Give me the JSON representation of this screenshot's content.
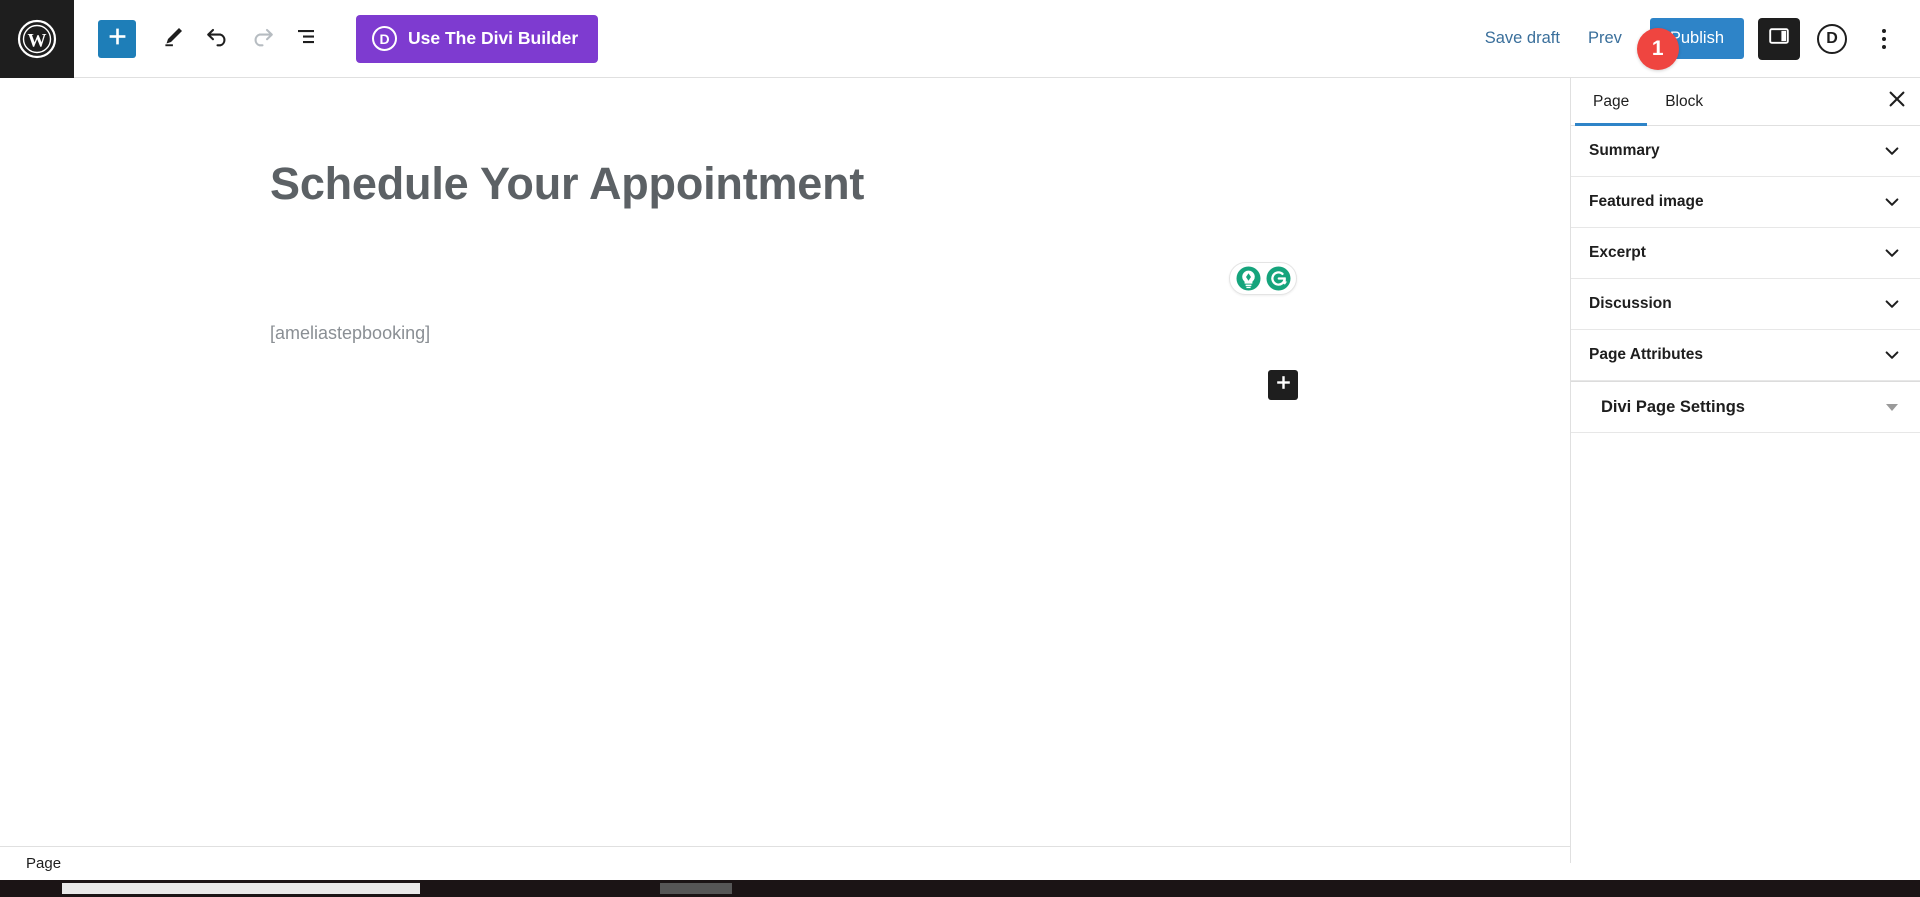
{
  "colors": {
    "accent_blue": "#2e84c8",
    "inserter_blue": "#1e7eb8",
    "divi_purple": "#7e3bd0",
    "badge_red": "#ef4540",
    "grammarly_green": "#15a47c",
    "dark": "#1e1e1e",
    "title_grey": "#5c6165",
    "muted_grey": "#8a8f94"
  },
  "topbar": {
    "wp_logo_icon": "wordpress-logo-icon",
    "left_tools": [
      {
        "icon": "plus-icon",
        "name": "block-inserter-button",
        "label": "Toggle block inserter"
      },
      {
        "icon": "pencil-icon",
        "name": "tools-edit-button",
        "label": "Tools"
      },
      {
        "icon": "undo-arrow-icon",
        "name": "undo-button",
        "label": "Undo"
      },
      {
        "icon": "redo-arrow-icon",
        "name": "redo-button",
        "label": "Redo"
      },
      {
        "icon": "list-view-icon",
        "name": "document-overview-button",
        "label": "Document overview"
      }
    ],
    "divi_builder": {
      "icon": "divi-d-circle-icon",
      "icon_letter": "D",
      "label": "Use The Divi Builder"
    },
    "save_draft_label": "Save draft",
    "preview_label": "Prev",
    "notification_badge": "1",
    "publish_label": "Publish",
    "settings_toggle_icon": "sidebar-panel-icon",
    "divi_icon_letter": "D",
    "options_icon": "kebab-menu-icon"
  },
  "canvas": {
    "post_title": "Schedule Your Appointment",
    "paragraph": "[ameliastepbooking]",
    "grammarly": {
      "bulb_icon": "grammarly-lightbulb-icon",
      "rewrite_icon": "grammarly-rewrite-icon"
    },
    "block_appender_icon": "plus-icon"
  },
  "sidebar": {
    "tabs": [
      {
        "label": "Page",
        "active": true
      },
      {
        "label": "Block",
        "active": false
      }
    ],
    "close_icon": "close-icon",
    "panels": [
      {
        "label": "Summary",
        "icon": "chevron-down-icon"
      },
      {
        "label": "Featured image",
        "icon": "chevron-down-icon"
      },
      {
        "label": "Excerpt",
        "icon": "chevron-down-icon"
      },
      {
        "label": "Discussion",
        "icon": "chevron-down-icon"
      },
      {
        "label": "Page Attributes",
        "icon": "chevron-down-icon"
      }
    ],
    "divi_panel": {
      "label": "Divi Page Settings",
      "icon": "triangle-down-icon"
    }
  },
  "bottombar": {
    "breadcrumb": "Page"
  }
}
